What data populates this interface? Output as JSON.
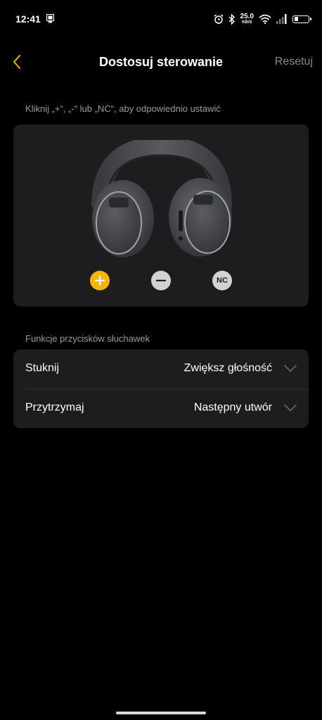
{
  "status_bar": {
    "time": "12:41",
    "net_speed_value": "25.0",
    "net_speed_unit": "KB/S"
  },
  "header": {
    "title": "Dostosuj sterowanie",
    "reset_label": "Resetuj"
  },
  "hint": "Kliknij „+“, „-“ lub „NC“, aby odpowiednio ustawić",
  "controls": {
    "plus": "+",
    "minus": "−",
    "nc": "NC",
    "active": "plus",
    "active_color": "#f5b40a"
  },
  "section_title": "Funkcje przycisków słuchawek",
  "settings": {
    "rows": [
      {
        "label": "Stuknij",
        "value": "Zwiększ głośność"
      },
      {
        "label": "Przytrzymaj",
        "value": "Następny utwór"
      }
    ]
  },
  "colors": {
    "accent": "#f5b40a",
    "background": "#000000",
    "card": "#1d1d1f"
  }
}
